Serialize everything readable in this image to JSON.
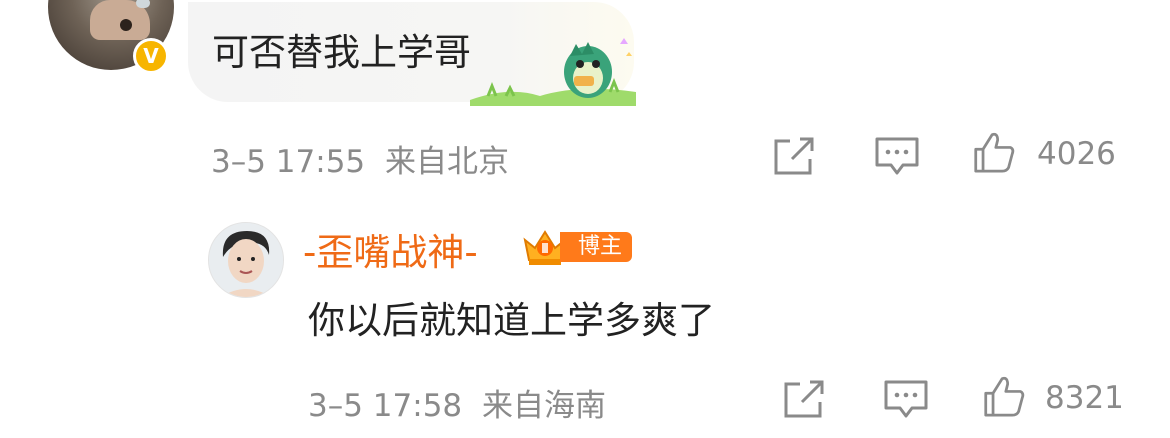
{
  "comment1": {
    "message": "可否替我上学哥",
    "time": "3–5 17:55",
    "location": "来自北京",
    "likes": "4026",
    "badge": "V"
  },
  "comment2": {
    "username": "-歪嘴战神-",
    "badge_label": "博主",
    "message": "你以后就知道上学多爽了",
    "time": "3–5 17:58",
    "location": "来自海南",
    "likes": "8321"
  },
  "colors": {
    "username": "#ef6a16",
    "meta": "#8a8a8a",
    "bozhu_badge": "#ff7a1a",
    "verified_badge": "#f7b500"
  },
  "icons": [
    "share-icon",
    "comment-icon",
    "like-icon",
    "crown-icon",
    "verified-icon",
    "dinosaur-sticker"
  ]
}
